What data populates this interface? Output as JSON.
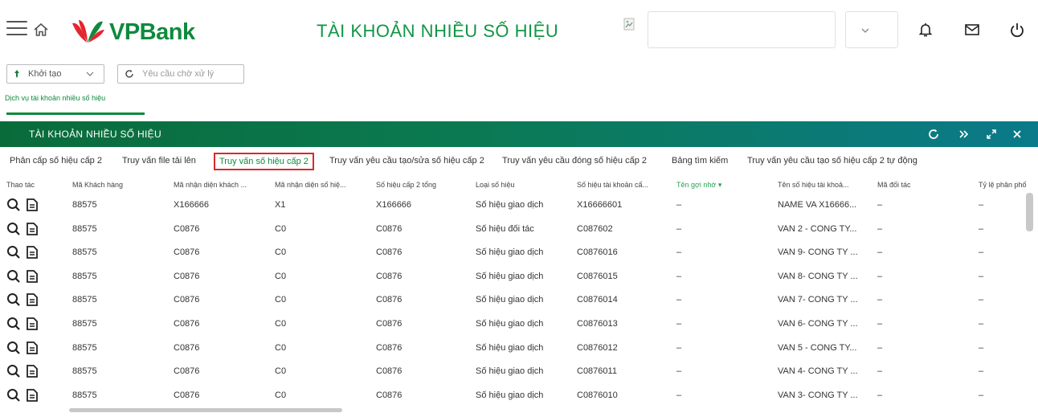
{
  "header": {
    "brand": "VPBank",
    "page_title": "TÀI KHOẢN NHIỀU SỐ HIỆU",
    "colors": {
      "brand_green": "#0e8a3c",
      "brand_red": "#e3262f"
    }
  },
  "toolbar": {
    "action_select_label": "Khởi tạo",
    "request_input_placeholder": "Yêu cầu chờ xử lý"
  },
  "breadcrumb": {
    "subtab_label": "Dịch vụ tài khoản nhiều số hiệu"
  },
  "section": {
    "title": "TÀI KHOẢN NHIỀU SỐ HIỆU"
  },
  "tabs": [
    {
      "label": "Phân cấp số hiệu cấp 2"
    },
    {
      "label": "Truy vấn file tải lên"
    },
    {
      "label": "Truy vấn số hiệu cấp 2"
    },
    {
      "label": "Truy vấn yêu cầu tạo/sửa số hiệu cấp 2"
    },
    {
      "label": "Truy vấn yêu cầu đóng số hiệu cấp 2"
    },
    {
      "label": "Bảng tìm kiếm"
    },
    {
      "label": "Truy vấn yêu cầu tạo số hiệu cấp 2 tự động"
    }
  ],
  "active_tab_index": 2,
  "table": {
    "columns": [
      "Thao tác",
      "Mã Khách hàng",
      "Mã nhận diện khách ...",
      "Mã nhận diện số hiệ...",
      "Số hiệu cấp 2 tổng",
      "Loại số hiệu",
      "Số hiệu tài khoản cấ...",
      "Tên gợi nhớ ▾",
      "Tên số hiệu tài khoả...",
      "Mã đối tác",
      "Tỷ lệ phân phố"
    ],
    "rows": [
      [
        "88575",
        "X166666",
        "X1",
        "X166666",
        "Số hiệu giao dịch",
        "X16666601",
        "–",
        "NAME VA X16666...",
        "–",
        "–"
      ],
      [
        "88575",
        "C0876",
        "C0",
        "C0876",
        "Số hiệu đối tác",
        "C087602",
        "–",
        "VAN 2 - CONG TY...",
        "–",
        "–"
      ],
      [
        "88575",
        "C0876",
        "C0",
        "C0876",
        "Số hiệu giao dịch",
        "C0876016",
        "–",
        "VAN 9- CONG TY ...",
        "–",
        "–"
      ],
      [
        "88575",
        "C0876",
        "C0",
        "C0876",
        "Số hiệu giao dịch",
        "C0876015",
        "–",
        "VAN 8- CONG TY ...",
        "–",
        "–"
      ],
      [
        "88575",
        "C0876",
        "C0",
        "C0876",
        "Số hiệu giao dịch",
        "C0876014",
        "–",
        "VAN 7- CONG TY ...",
        "–",
        "–"
      ],
      [
        "88575",
        "C0876",
        "C0",
        "C0876",
        "Số hiệu giao dịch",
        "C0876013",
        "–",
        "VAN 6- CONG TY ...",
        "–",
        "–"
      ],
      [
        "88575",
        "C0876",
        "C0",
        "C0876",
        "Số hiệu giao dịch",
        "C0876012",
        "–",
        "VAN 5 - CONG TY...",
        "–",
        "–"
      ],
      [
        "88575",
        "C0876",
        "C0",
        "C0876",
        "Số hiệu giao dịch",
        "C0876011",
        "–",
        "VAN 4- CONG TY ...",
        "–",
        "–"
      ],
      [
        "88575",
        "C0876",
        "C0",
        "C0876",
        "Số hiệu giao dịch",
        "C0876010",
        "–",
        "VAN 3- CONG TY ...",
        "–",
        "–"
      ]
    ]
  }
}
